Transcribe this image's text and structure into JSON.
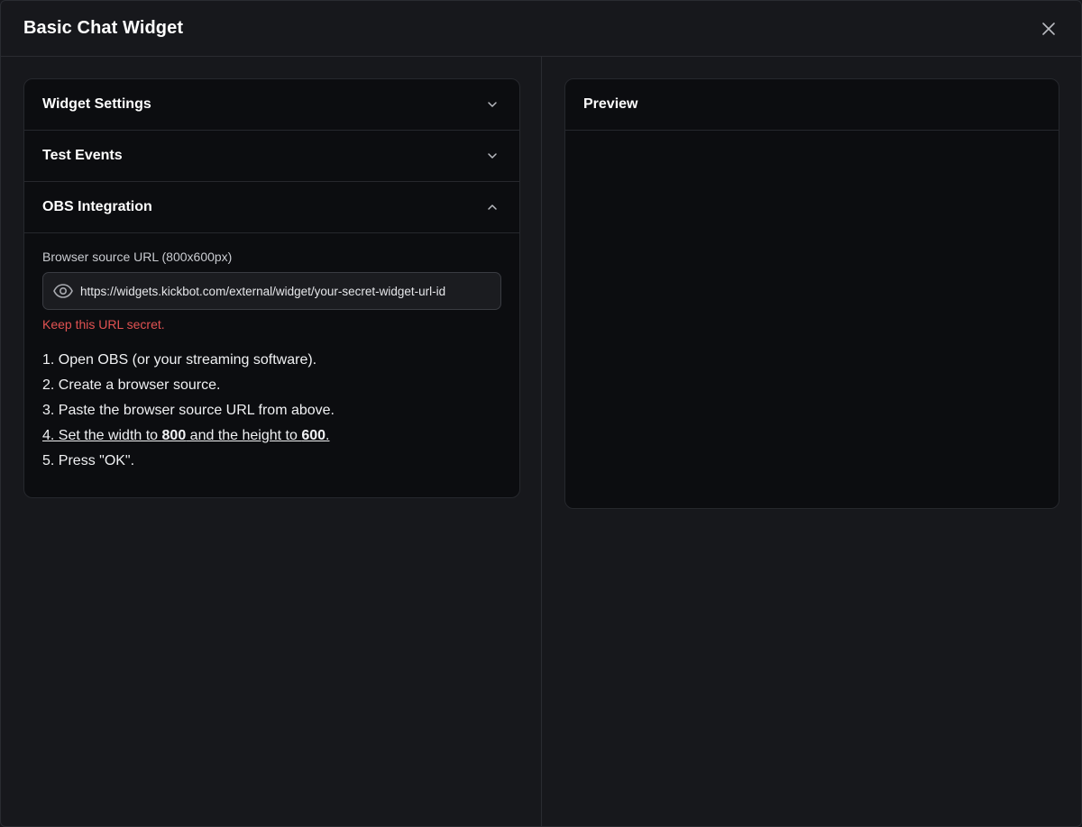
{
  "modal": {
    "title": "Basic Chat Widget"
  },
  "icons": {
    "close": "close-icon",
    "chevron_down": "chevron-down-icon",
    "chevron_up": "chevron-up-icon",
    "eye": "eye-icon"
  },
  "accordion": {
    "sections": [
      {
        "label": "Widget Settings",
        "expanded": false
      },
      {
        "label": "Test Events",
        "expanded": false
      },
      {
        "label": "OBS Integration",
        "expanded": true
      }
    ],
    "obs": {
      "url_label": "Browser source URL (800x600px)",
      "url_value": "https://widgets.kickbot.com/external/widget/your-secret-widget-url-id",
      "warning": "Keep this URL secret.",
      "steps": {
        "s1": "1. Open OBS (or your streaming software).",
        "s2": "2. Create a browser source.",
        "s3": "3. Paste the browser source URL from above.",
        "s4_prefix": "4. Set the width to ",
        "s4_width": "800",
        "s4_middle": " and the height to ",
        "s4_height": "600",
        "s4_suffix": ".",
        "s5": "5. Press \"OK\"."
      }
    }
  },
  "preview": {
    "title": "Preview"
  },
  "colors": {
    "background": "#17181c",
    "panel": "#0c0d10",
    "border": "#26282d",
    "warning": "#e25252"
  }
}
